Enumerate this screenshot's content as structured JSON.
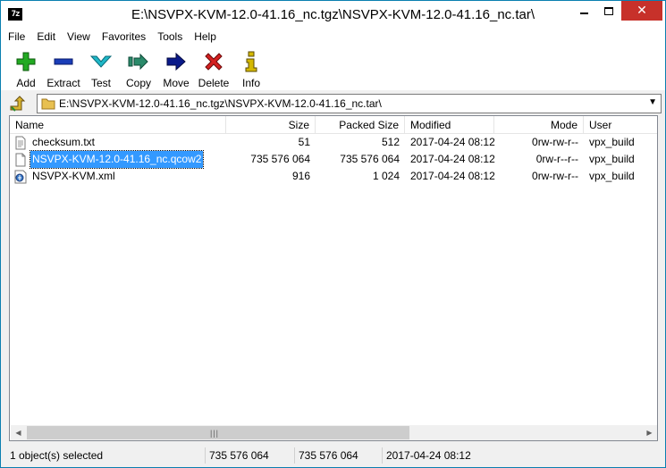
{
  "window": {
    "title": "E:\\NSVPX-KVM-12.0-41.16_nc.tgz\\NSVPX-KVM-12.0-41.16_nc.tar\\",
    "app_icon": "7z",
    "close_color": "#c7312a"
  },
  "menu": [
    "File",
    "Edit",
    "View",
    "Favorites",
    "Tools",
    "Help"
  ],
  "toolbar": [
    {
      "label": "Add",
      "icon": "plus-icon"
    },
    {
      "label": "Extract",
      "icon": "minus-icon"
    },
    {
      "label": "Test",
      "icon": "check-icon"
    },
    {
      "label": "Copy",
      "icon": "copy-arrow-icon"
    },
    {
      "label": "Move",
      "icon": "move-arrow-icon"
    },
    {
      "label": "Delete",
      "icon": "delete-x-icon"
    },
    {
      "label": "Info",
      "icon": "info-icon"
    }
  ],
  "address": {
    "path": "E:\\NSVPX-KVM-12.0-41.16_nc.tgz\\NSVPX-KVM-12.0-41.16_nc.tar\\"
  },
  "columns": [
    "Name",
    "Size",
    "Packed Size",
    "Modified",
    "Mode",
    "User"
  ],
  "files": [
    {
      "name": "checksum.txt",
      "size": "51",
      "packed": "512",
      "modified": "2017-04-24 08:12",
      "mode": "0rw-rw-r--",
      "user": "vpx_build",
      "icon": "text-file-icon",
      "selected": false
    },
    {
      "name": "NSVPX-KVM-12.0-41.16_nc.qcow2",
      "size": "735 576 064",
      "packed": "735 576 064",
      "modified": "2017-04-24 08:12",
      "mode": "0rw-r--r--",
      "user": "vpx_build",
      "icon": "file-icon",
      "selected": true
    },
    {
      "name": "NSVPX-KVM.xml",
      "size": "916",
      "packed": "1 024",
      "modified": "2017-04-24 08:12",
      "mode": "0rw-rw-r--",
      "user": "vpx_build",
      "icon": "xml-file-icon",
      "selected": false
    }
  ],
  "status": {
    "selected": "1 object(s) selected",
    "size": "735 576 064",
    "packed": "735 576 064",
    "modified": "2017-04-24 08:12"
  },
  "colors": {
    "selection": "#3399ff",
    "add": "#22aa22",
    "extract": "#1a3db8",
    "test": "#1fb8c8",
    "copy": "#2a8a6a",
    "move": "#0a1a8a",
    "delete": "#d42020",
    "info": "#d4b800"
  }
}
